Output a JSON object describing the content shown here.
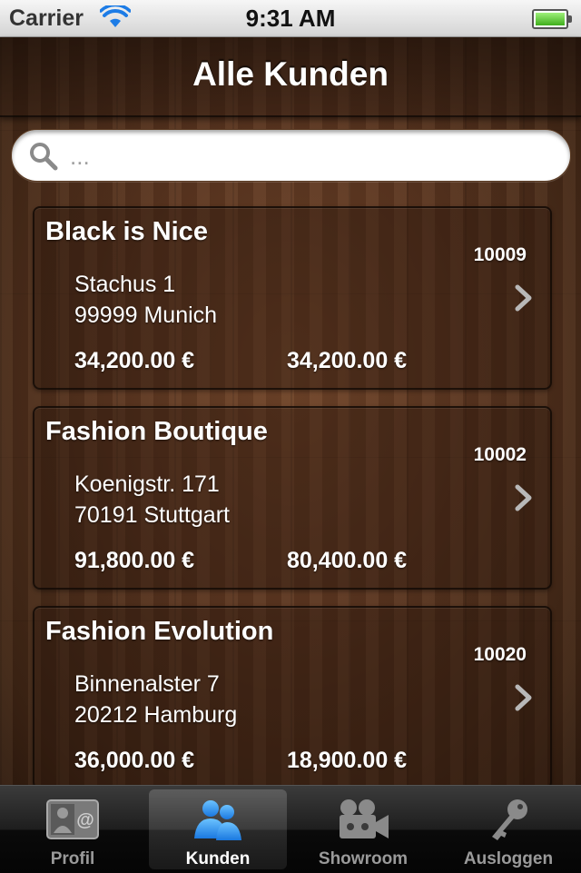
{
  "status_bar": {
    "carrier": "Carrier",
    "time": "9:31 AM"
  },
  "nav": {
    "title": "Alle Kunden"
  },
  "search": {
    "placeholder": "..."
  },
  "customers": [
    {
      "name": "Black is Nice",
      "id": "10009",
      "street": "Stachus 1",
      "city": "99999 Munich",
      "amount1": "34,200.00  €",
      "amount2": "34,200.00  €"
    },
    {
      "name": "Fashion Boutique",
      "id": "10002",
      "street": "Koenigstr. 171",
      "city": "70191 Stuttgart",
      "amount1": "91,800.00  €",
      "amount2": "80,400.00  €"
    },
    {
      "name": "Fashion Evolution",
      "id": "10020",
      "street": "Binnenalster 7",
      "city": "20212 Hamburg",
      "amount1": "36,000.00  €",
      "amount2": "18,900.00  €"
    }
  ],
  "tabs": [
    {
      "label": "Profil",
      "icon": "contact-card-icon",
      "active": false
    },
    {
      "label": "Kunden",
      "icon": "people-icon",
      "active": true
    },
    {
      "label": "Showroom",
      "icon": "video-camera-icon",
      "active": false
    },
    {
      "label": "Ausloggen",
      "icon": "key-icon",
      "active": false
    }
  ],
  "colors": {
    "tab_active": "#1e90ff",
    "wood": "#5a3520"
  }
}
